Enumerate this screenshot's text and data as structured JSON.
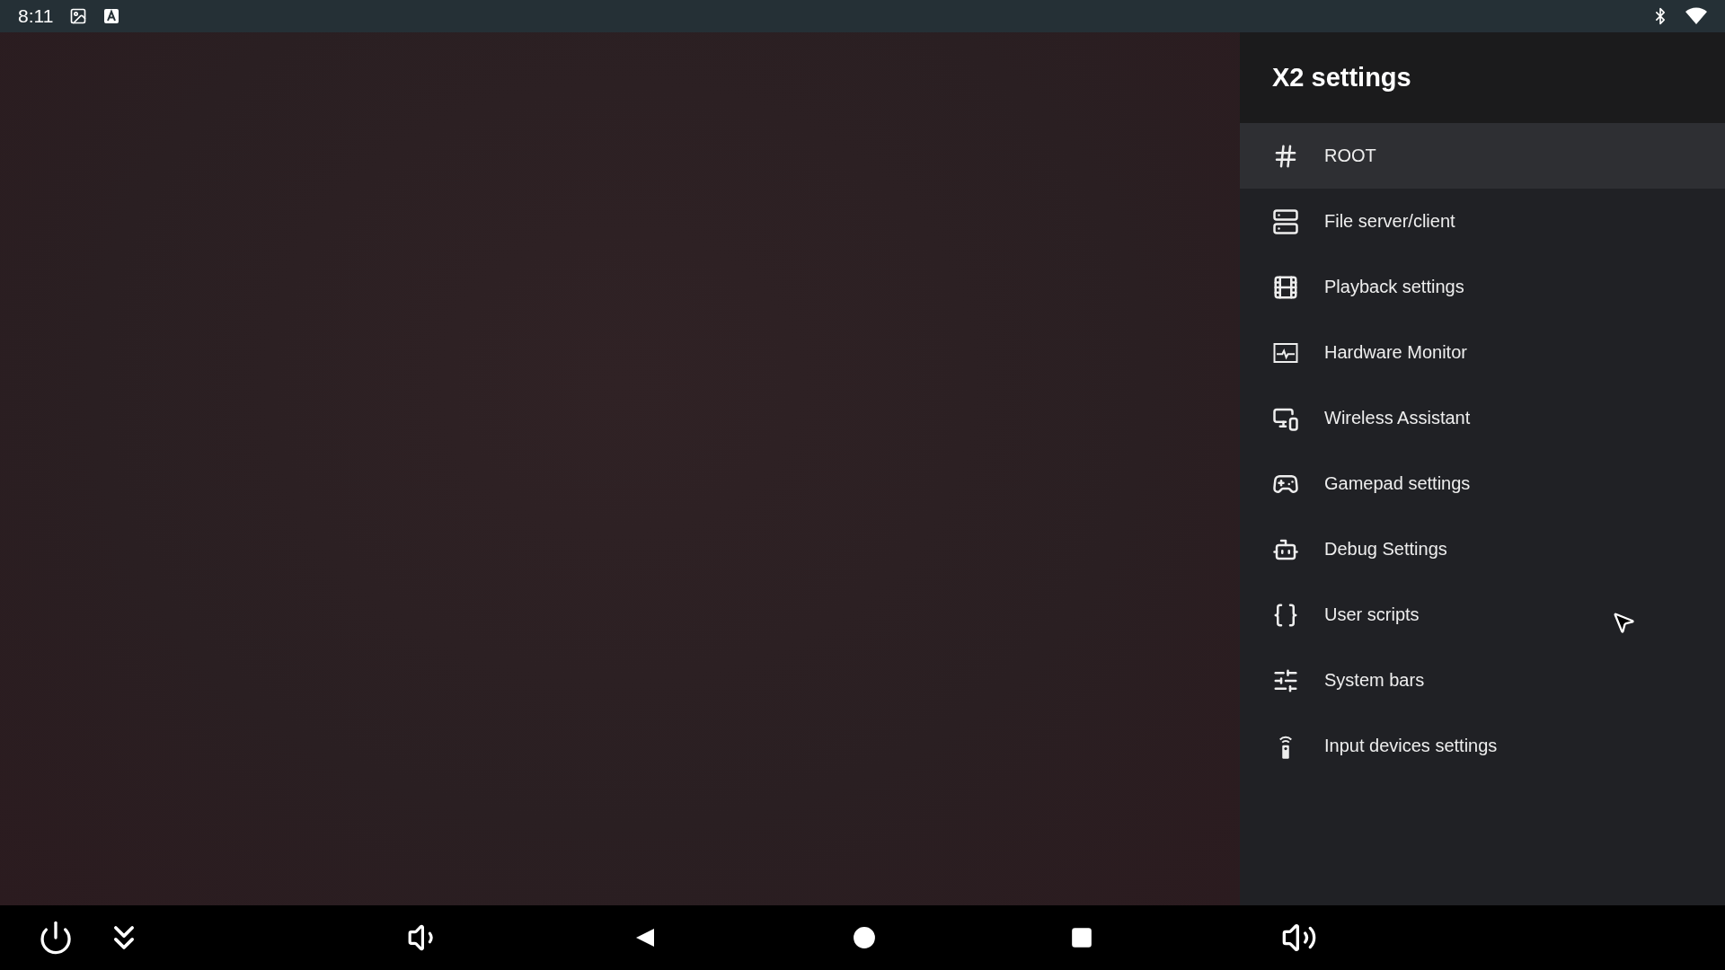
{
  "status_bar": {
    "time": "8:11"
  },
  "panel": {
    "title": "X2 settings",
    "items": [
      {
        "label": "ROOT",
        "selected": true
      },
      {
        "label": "File server/client",
        "selected": false
      },
      {
        "label": "Playback settings",
        "selected": false
      },
      {
        "label": "Hardware Monitor",
        "selected": false
      },
      {
        "label": "Wireless Assistant",
        "selected": false
      },
      {
        "label": "Gamepad settings",
        "selected": false
      },
      {
        "label": "Debug Settings",
        "selected": false
      },
      {
        "label": "User scripts",
        "selected": false
      },
      {
        "label": "System bars",
        "selected": false
      },
      {
        "label": "Input devices settings",
        "selected": false
      }
    ]
  }
}
